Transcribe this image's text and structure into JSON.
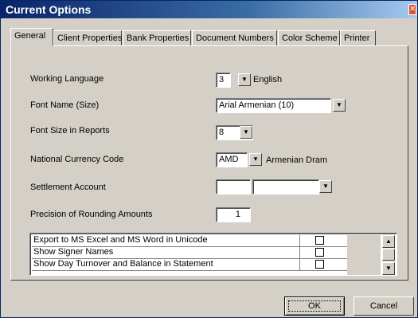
{
  "window": {
    "title": "Current Options",
    "close_glyph": "✕"
  },
  "tabs": [
    {
      "label": "General",
      "active": true
    },
    {
      "label": "Client Properties"
    },
    {
      "label": "Bank Properties"
    },
    {
      "label": "Document Numbers"
    },
    {
      "label": "Color Scheme"
    },
    {
      "label": "Printer"
    }
  ],
  "fields": {
    "working_language": {
      "label": "Working Language",
      "value": "3",
      "text": "English"
    },
    "font_name": {
      "label": "Font Name (Size)",
      "value": "Arial Armenian (10)"
    },
    "font_size_reports": {
      "label": "Font Size in Reports",
      "value": "8"
    },
    "currency_code": {
      "label": "National Currency Code",
      "value": "AMD",
      "text": "Armenian Dram"
    },
    "settlement_account": {
      "label": "Settlement Account",
      "value1": "",
      "value2": ""
    },
    "rounding_precision": {
      "label": "Precision of Rounding Amounts",
      "value": "1"
    }
  },
  "options": [
    {
      "label": "Export to MS Excel and MS Word in Unicode",
      "checked": false
    },
    {
      "label": "Show Signer Names",
      "checked": false
    },
    {
      "label": "Show Day Turnover and Balance in Statement",
      "checked": false
    }
  ],
  "buttons": {
    "ok": "OK",
    "cancel": "Cancel"
  },
  "icons": {
    "dropdown": "chevron-down-icon",
    "scroll_up": "arrow-up-icon",
    "scroll_down": "arrow-down-icon"
  }
}
